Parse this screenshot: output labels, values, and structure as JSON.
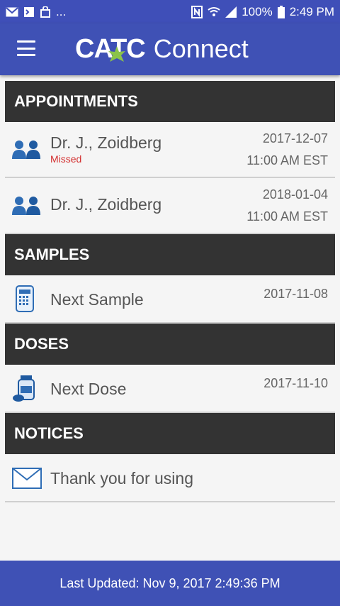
{
  "status_bar": {
    "left_icons": [
      "mail-icon",
      "flag-icon",
      "bag-icon"
    ],
    "overflow": "...",
    "battery": "100%",
    "time": "2:49 PM"
  },
  "app_bar": {
    "logo_brand": "CATC",
    "logo_word": "Connect",
    "colors": {
      "primary": "#3f51b5",
      "leaf": "#8bc34a"
    }
  },
  "sections": {
    "appointments": {
      "title": "APPOINTMENTS",
      "items": [
        {
          "name": "Dr. J., Zoidberg",
          "status": "Missed",
          "date": "2017-12-07",
          "time": "11:00 AM EST"
        },
        {
          "name": "Dr. J., Zoidberg",
          "date": "2018-01-04",
          "time": "11:00 AM EST"
        }
      ]
    },
    "samples": {
      "title": "SAMPLES",
      "items": [
        {
          "name": "Next Sample",
          "date": "2017-11-08"
        }
      ]
    },
    "doses": {
      "title": "DOSES",
      "items": [
        {
          "name": "Next Dose",
          "date": "2017-11-10"
        }
      ]
    },
    "notices": {
      "title": "NOTICES",
      "items": [
        {
          "name": "Thank you for using"
        }
      ]
    }
  },
  "footer": {
    "last_updated": "Last Updated: Nov 9, 2017 2:49:36 PM"
  }
}
